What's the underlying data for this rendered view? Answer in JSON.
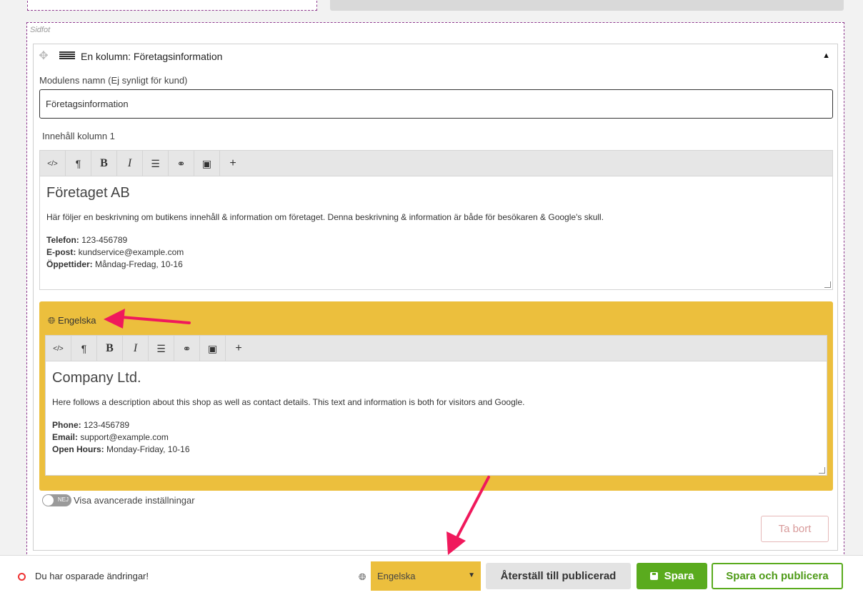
{
  "region": {
    "label": "Sidfot"
  },
  "module": {
    "title": "En kolumn: Företagsinformation",
    "name_label": "Modulens namn (Ej synligt för kund)",
    "name_value": "Företagsinformation",
    "column_label": "Innehåll kolumn 1"
  },
  "toolbar_icons": [
    "code-icon",
    "paragraph-icon",
    "bold-icon",
    "italic-icon",
    "list-icon",
    "link-icon",
    "image-icon",
    "plus-icon"
  ],
  "editor_sv": {
    "heading": "Företaget AB",
    "description": "Här följer en beskrivning om butikens innehåll & information om företaget. Denna beskrivning & information är både för besökaren & Google's skull.",
    "phone_label": "Telefon:",
    "phone_value": " 123-456789",
    "email_label": "E-post:",
    "email_value": " kundservice@example.com",
    "hours_label": "Öppettider:",
    "hours_value": " Måndag-Fredag, 10-16"
  },
  "translation": {
    "language_label": "Engelska",
    "heading": "Company Ltd.",
    "description": "Here follows a description about this shop as well as contact details. This text and information is both for visitors and Google.",
    "phone_label": "Phone:",
    "phone_value": " 123-456789",
    "email_label": "Email:",
    "email_value": " support@example.com",
    "hours_label": "Open Hours:",
    "hours_value": " Monday-Friday, 10-16",
    "panel_color": "#ecbf3d"
  },
  "advanced": {
    "toggle_text": "NEJ",
    "label": "Visa avancerade inställningar",
    "enabled": false
  },
  "remove_label": "Ta bort",
  "bottom_bar": {
    "unsaved_text": "Du har osparade ändringar!",
    "language_select": "Engelska",
    "reset_label": "Återställ till publicerad",
    "save_label": "Spara",
    "publish_label": "Spara och publicera",
    "save_color": "#5aab1e"
  },
  "annotations": {
    "arrow_color": "#f0195c"
  }
}
